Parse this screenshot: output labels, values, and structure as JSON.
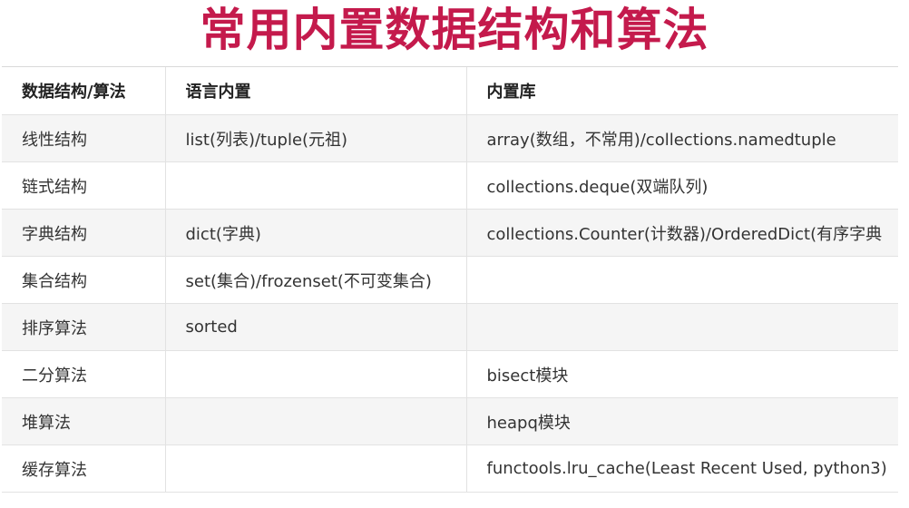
{
  "title": "常用内置数据结构和算法",
  "table": {
    "headers": [
      "数据结构/算法",
      "语言内置",
      "内置库"
    ],
    "rows": [
      [
        "线性结构",
        "list(列表)/tuple(元祖)",
        "array(数组，不常用)/collections.namedtuple"
      ],
      [
        "链式结构",
        "",
        "collections.deque(双端队列)"
      ],
      [
        "字典结构",
        "dict(字典)",
        "collections.Counter(计数器)/OrderedDict(有序字典"
      ],
      [
        "集合结构",
        "set(集合)/frozenset(不可变集合)",
        ""
      ],
      [
        "排序算法",
        "sorted",
        ""
      ],
      [
        "二分算法",
        "",
        "bisect模块"
      ],
      [
        "堆算法",
        "",
        "heapq模块"
      ],
      [
        "缓存算法",
        "",
        "functools.lru_cache(Least Recent Used, python3)"
      ]
    ]
  }
}
